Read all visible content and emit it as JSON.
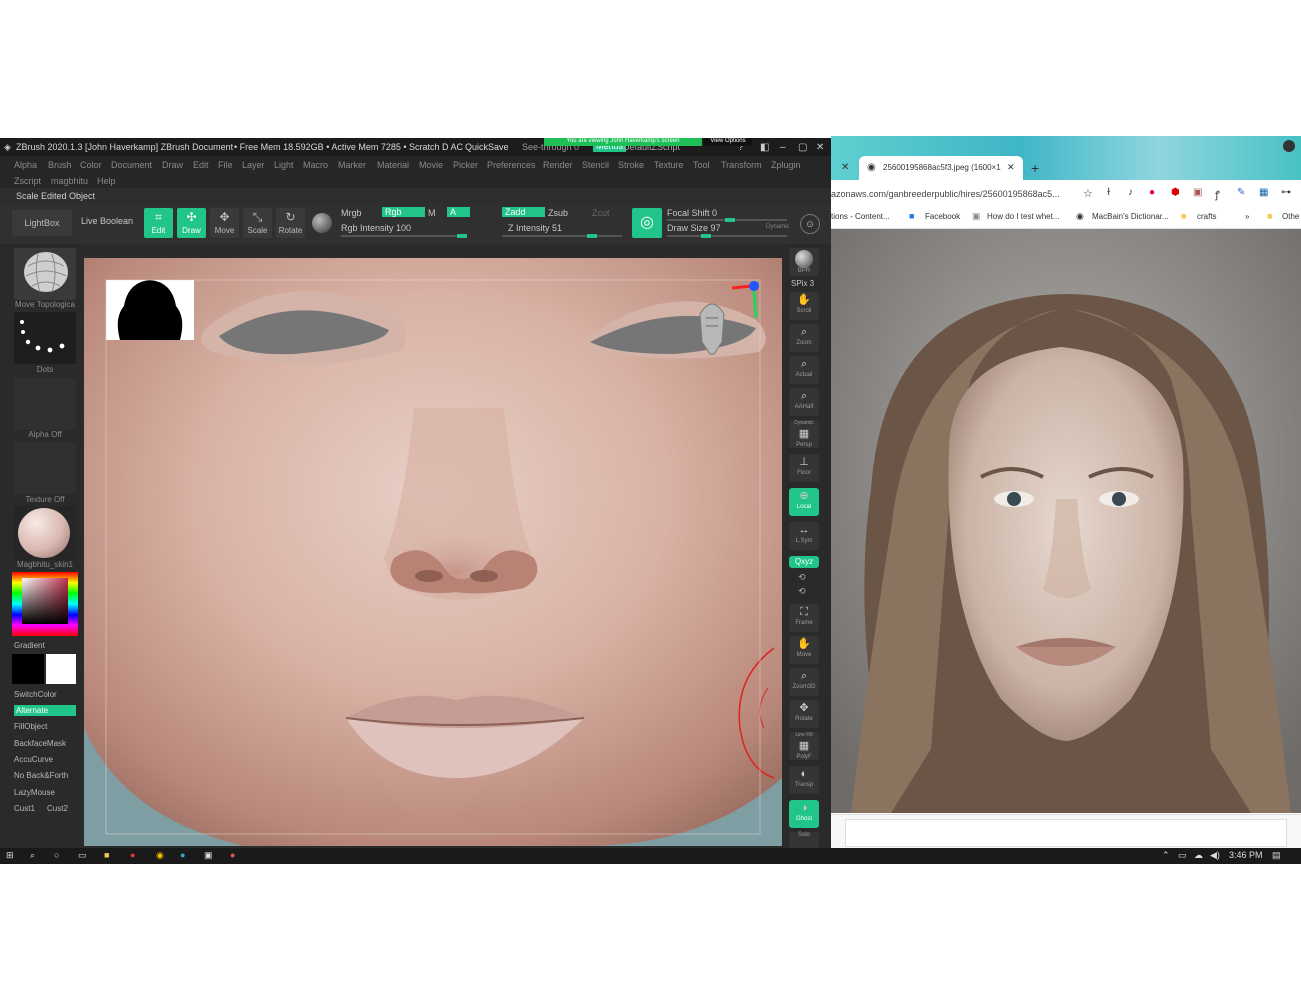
{
  "zbrush": {
    "title": "ZBrush 2020.1.3 [John Haverkamp]  ZBrush Document",
    "mem": "• Free Mem 18.592GB • Active Mem 7285 • Scratch D  AC",
    "quicksave": "QuickSave",
    "seethrough": "See-through  0",
    "menus": "Menus",
    "script": "DefaultZScript",
    "viewing_banner": "You are viewing John Haverkamp's screen",
    "view_options": "View Options",
    "menu_row1": [
      "Alpha",
      "Brush",
      "Color",
      "Document",
      "Draw",
      "Edit",
      "File",
      "Layer",
      "Light",
      "Macro",
      "Marker",
      "Material",
      "Movie",
      "Picker",
      "Preferences",
      "Render",
      "Stencil",
      "Stroke",
      "Texture",
      "Tool",
      "Transform",
      "Zplugin"
    ],
    "menu_row2": [
      "Zscript",
      "magbhitu",
      "Help"
    ],
    "status": "Scale Edited Object",
    "lightbox": "LightBox",
    "live_boolean": "Live Boolean",
    "modes": [
      "Edit",
      "Draw",
      "Move",
      "Scale",
      "Rotate"
    ],
    "mrgb": "Mrgb",
    "rgb": "Rgb",
    "m": "M",
    "a": "A",
    "rgb_intensity": "Rgb Intensity 100",
    "zadd": "Zadd",
    "zsub": "Zsub",
    "zcut": "Zcut",
    "z_intensity": "Z Intensity 51",
    "focal_shift": "Focal Shift 0",
    "draw_size": "Draw Size 97",
    "dynamic": "Dynamic",
    "left_panel": {
      "move_brush": "Move Topologica",
      "dots": "Dots",
      "alpha": "Alpha Off",
      "texture": "Texture Off",
      "material": "Magbhitu_skin1",
      "gradient": "Gradient",
      "switchcolor": "SwitchColor",
      "alternate": "Alternate",
      "options": [
        "FillObject",
        "BackfaceMask",
        "AccuCurve",
        "No Back&Forth",
        "LazyMouse"
      ],
      "cust1": "Cust1",
      "cust2": "Cust2"
    },
    "right_panel": {
      "bpr": "BPR",
      "spix": "SPix 3",
      "buttons": [
        "Scroll",
        "Zoom",
        "Actual",
        "AAHalf",
        "Persp",
        "Floor",
        "Local",
        "L.Sym",
        "Qxyz",
        "Frame",
        "Move",
        "Zoom3D",
        "Rotate",
        "PolyF",
        "Transp",
        "Ghost",
        "Solo"
      ],
      "dynamic": "Dynamic",
      "line_fill": "Line Fill"
    }
  },
  "chrome": {
    "tab_title": "25600195868ac5f3.jpeg (1600×1",
    "url": "azonaws.com/ganbreederpublic/hires/25600195868ac5...",
    "bookmarks": [
      "tions - Content...",
      "Facebook",
      "How do I test whet...",
      "MacBain's Dictionar...",
      "crafts",
      "»",
      "Othe"
    ]
  },
  "taskbar": {
    "time": "3:46 PM"
  },
  "colors": {
    "accent": "#21c58a",
    "zbrush_bg": "#2b2b2b"
  }
}
